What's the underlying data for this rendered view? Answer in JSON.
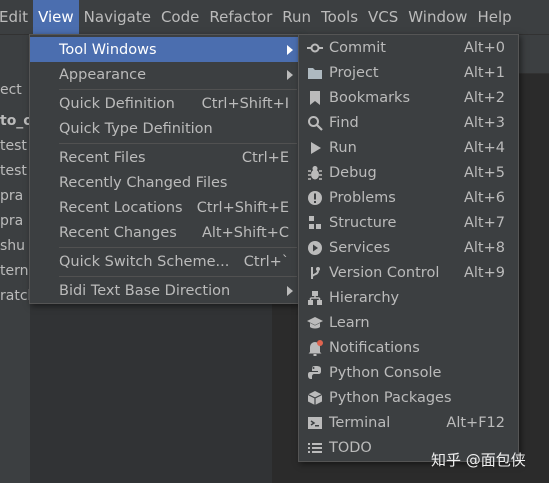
{
  "menubar": {
    "items": [
      "Edit",
      "View",
      "Navigate",
      "Code",
      "Refactor",
      "Run",
      "Tools",
      "VCS",
      "Window",
      "Help"
    ]
  },
  "sidebar": {
    "lines": [
      "ect",
      "to_o",
      "test",
      "test",
      "pra",
      "pra",
      "shu",
      "terna",
      "ratch"
    ]
  },
  "view_menu": {
    "items": [
      {
        "label": "Tool Windows",
        "shortcut": "",
        "submenu": true
      },
      {
        "label": "Appearance",
        "shortcut": "",
        "submenu": true
      },
      {
        "label": "Quick Definition",
        "shortcut": "Ctrl+Shift+I",
        "submenu": false
      },
      {
        "label": "Quick Type Definition",
        "shortcut": "",
        "submenu": false
      },
      {
        "label": "Recent Files",
        "shortcut": "Ctrl+E",
        "submenu": false
      },
      {
        "label": "Recently Changed Files",
        "shortcut": "",
        "submenu": false
      },
      {
        "label": "Recent Locations",
        "shortcut": "Ctrl+Shift+E",
        "submenu": false
      },
      {
        "label": "Recent Changes",
        "shortcut": "Alt+Shift+C",
        "submenu": false
      },
      {
        "label": "Quick Switch Scheme...",
        "shortcut": "Ctrl+`",
        "submenu": false
      },
      {
        "label": "Bidi Text Base Direction",
        "shortcut": "",
        "submenu": true
      }
    ]
  },
  "tool_windows_menu": {
    "items": [
      {
        "label": "Commit",
        "shortcut": "Alt+0",
        "icon": "commit-icon"
      },
      {
        "label": "Project",
        "shortcut": "Alt+1",
        "icon": "folder-icon"
      },
      {
        "label": "Bookmarks",
        "shortcut": "Alt+2",
        "icon": "bookmark-icon"
      },
      {
        "label": "Find",
        "shortcut": "Alt+3",
        "icon": "search-icon"
      },
      {
        "label": "Run",
        "shortcut": "Alt+4",
        "icon": "play-icon"
      },
      {
        "label": "Debug",
        "shortcut": "Alt+5",
        "icon": "bug-icon"
      },
      {
        "label": "Problems",
        "shortcut": "Alt+6",
        "icon": "warning-icon"
      },
      {
        "label": "Structure",
        "shortcut": "Alt+7",
        "icon": "structure-icon"
      },
      {
        "label": "Services",
        "shortcut": "Alt+8",
        "icon": "services-icon"
      },
      {
        "label": "Version Control",
        "shortcut": "Alt+9",
        "icon": "branch-icon"
      },
      {
        "label": "Hierarchy",
        "shortcut": "",
        "icon": "hierarchy-icon"
      },
      {
        "label": "Learn",
        "shortcut": "",
        "icon": "graduation-cap-icon"
      },
      {
        "label": "Notifications",
        "shortcut": "",
        "icon": "bell-icon"
      },
      {
        "label": "Python Console",
        "shortcut": "",
        "icon": "python-icon"
      },
      {
        "label": "Python Packages",
        "shortcut": "",
        "icon": "packages-icon"
      },
      {
        "label": "Terminal",
        "shortcut": "Alt+F12",
        "icon": "terminal-icon"
      },
      {
        "label": "TODO",
        "shortcut": "",
        "icon": "list-icon"
      }
    ]
  },
  "watermark": "知乎 @面包侠",
  "colors": {
    "menu_bg": "#3c3f41",
    "selection": "#4b6eaf",
    "text": "#bbbbbb",
    "notification_dot": "#e0644f"
  }
}
